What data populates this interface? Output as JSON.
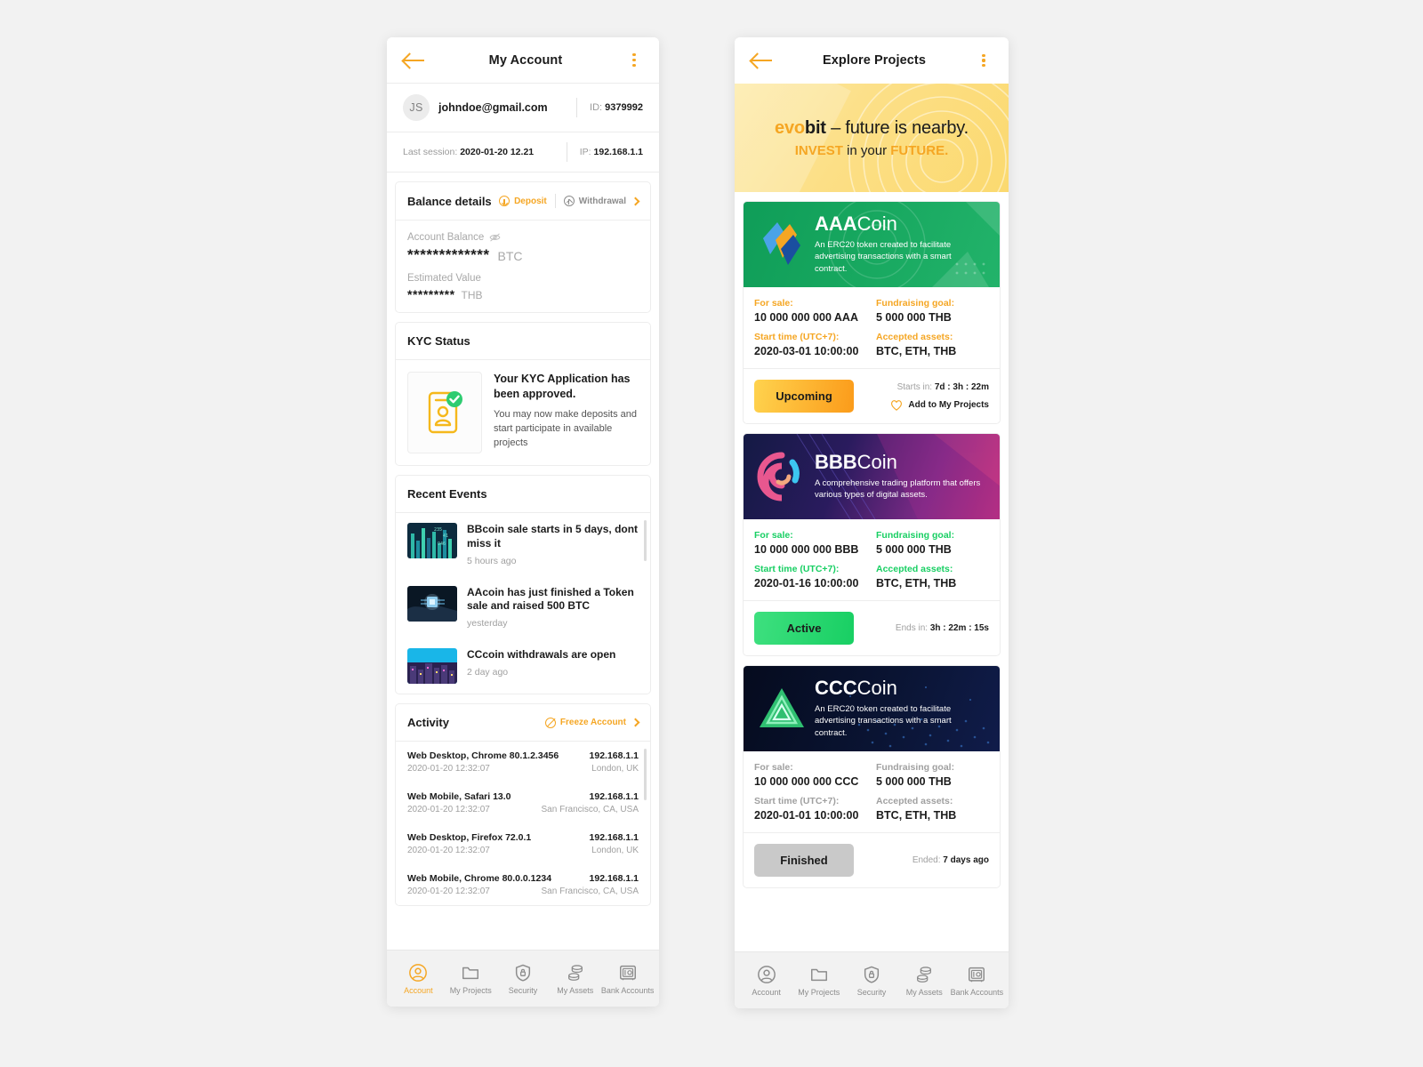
{
  "account": {
    "topbar": {
      "title": "My Account",
      "back_icon": "back-arrow-icon",
      "menu_icon": "kebab-menu-icon"
    },
    "profile": {
      "initials": "JS",
      "email": "johndoe@gmail.com",
      "id_label": "ID:",
      "id_value": "9379992"
    },
    "session": {
      "last_session_label": "Last session:",
      "last_session_value": "2020-01-20 12.21",
      "ip_label": "IP:",
      "ip_value": "192.168.1.1"
    },
    "balance": {
      "title": "Balance details",
      "deposit": "Deposit",
      "withdrawal": "Withdrawal",
      "account_balance_label": "Account Balance",
      "account_balance_masked": "*************",
      "account_balance_currency": "BTC",
      "estimated_label": "Estimated Value",
      "estimated_masked": "*********",
      "estimated_currency": "THB"
    },
    "kyc": {
      "title": "KYC Status",
      "headline": "Your KYC Application has been approved.",
      "sub": "You may now make deposits and start participate in available projects",
      "icon": "id-card-approved-icon"
    },
    "events": {
      "title": "Recent Events",
      "items": [
        {
          "title": "BBcoin sale starts in 5 days, dont miss it",
          "time": "5 hours ago",
          "thumb": "chart-bars-thumb"
        },
        {
          "title": "AAcoin has just finished a Token sale and raised 500 BTC",
          "time": "yesterday",
          "thumb": "chip-hand-thumb"
        },
        {
          "title": "CCcoin withdrawals are open",
          "time": "2 day ago",
          "thumb": "city-night-thumb"
        }
      ]
    },
    "activity": {
      "title": "Activity",
      "freeze_label": "Freeze Account",
      "rows": [
        {
          "device": "Web Desktop, Chrome 80.1.2.3456",
          "ip": "192.168.1.1",
          "date": "2020-01-20 12:32:07",
          "location": "London, UK"
        },
        {
          "device": "Web Mobile, Safari 13.0",
          "ip": "192.168.1.1",
          "date": "2020-01-20 12:32:07",
          "location": "San Francisco, CA, USA"
        },
        {
          "device": "Web Desktop, Firefox 72.0.1",
          "ip": "192.168.1.1",
          "date": "2020-01-20 12:32:07",
          "location": "London, UK"
        },
        {
          "device": "Web Mobile, Chrome 80.0.0.1234",
          "ip": "192.168.1.1",
          "date": "2020-01-20 12:32:07",
          "location": "San Francisco, CA, USA"
        }
      ]
    }
  },
  "explore": {
    "topbar": {
      "title": "Explore Projects",
      "back_icon": "back-arrow-icon",
      "menu_icon": "kebab-menu-icon"
    },
    "banner": {
      "brand_a": "evo",
      "brand_b": "bit",
      "tagline": " – future is nearby.",
      "line2_a": "INVEST",
      "line2_b": " in your ",
      "line2_c": "FUTURE."
    },
    "labels": {
      "for_sale": "For sale:",
      "fundraising_goal": "Fundraising goal:",
      "start_time": "Start time (UTC+7):",
      "accepted_assets": "Accepted assets:"
    },
    "projects": [
      {
        "name_bold": "AAA",
        "name_rest": "Coin",
        "desc": "An ERC20 token created to facilitate advertising transactions with a smart contract.",
        "logo": "aaacoin-logo-icon",
        "accent": "#f5a623",
        "for_sale": "10 000 000 000 AAA",
        "goal": "5 000 000 THB",
        "start_time": "2020-03-01 10:00:00",
        "assets": "BTC, ETH, THB",
        "status": "Upcoming",
        "status_kind": "upcoming",
        "meta_label": "Starts in:",
        "meta_value": "7d : 3h : 22m",
        "fav_label": "Add to My Projects"
      },
      {
        "name_bold": "BBB",
        "name_rest": "Coin",
        "desc": "A comprehensive trading platform that offers various types of digital assets.",
        "logo": "bbbcoin-logo-icon",
        "accent": "#18cf63",
        "for_sale": "10 000 000 000 BBB",
        "goal": "5 000 000 THB",
        "start_time": "2020-01-16 10:00:00",
        "assets": "BTC, ETH, THB",
        "status": "Active",
        "status_kind": "active",
        "meta_label": "Ends in:",
        "meta_value": "3h : 22m : 15s",
        "fav_label": ""
      },
      {
        "name_bold": "CCC",
        "name_rest": "Coin",
        "desc": "An ERC20 token created to facilitate advertising transactions with a smart contract.",
        "logo": "ccccoin-logo-icon",
        "accent": "#a0a0a0",
        "for_sale": "10 000 000 000 CCC",
        "goal": "5 000 000 THB",
        "start_time": "2020-01-01 10:00:00",
        "assets": "BTC, ETH, THB",
        "status": "Finished",
        "status_kind": "finished",
        "meta_label": "Ended:",
        "meta_value": "7 days ago",
        "fav_label": ""
      }
    ]
  },
  "bottom_nav": {
    "items": [
      {
        "label": "Account",
        "icon": "user-circle-icon"
      },
      {
        "label": "My Projects",
        "icon": "folder-icon"
      },
      {
        "label": "Security",
        "icon": "shield-lock-icon"
      },
      {
        "label": "My Assets",
        "icon": "coins-stack-icon"
      },
      {
        "label": "Bank Accounts",
        "icon": "safe-box-icon"
      }
    ],
    "active_index": 0
  }
}
